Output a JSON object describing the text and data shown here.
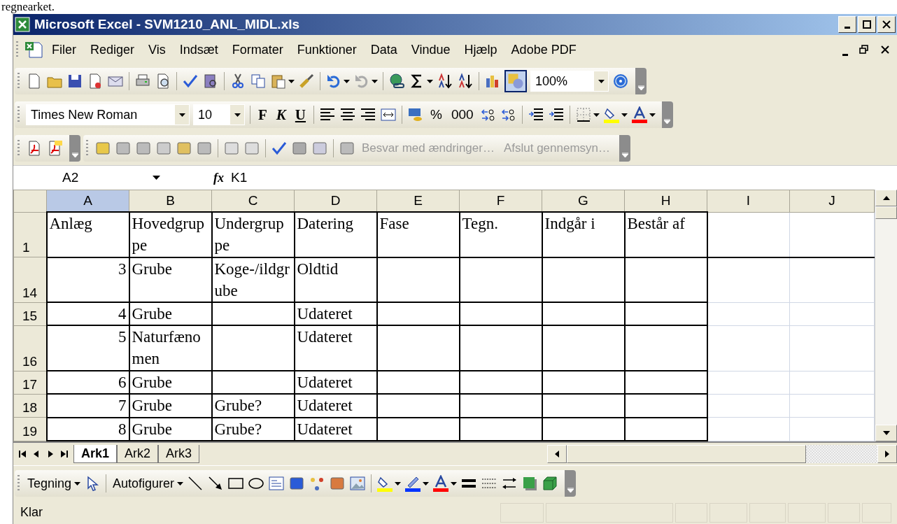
{
  "document_text": "regnearket.",
  "window": {
    "title": "Microsoft Excel - SVM1210_ANL_MIDL.xls"
  },
  "menu": [
    "Filer",
    "Rediger",
    "Vis",
    "Indsæt",
    "Formater",
    "Funktioner",
    "Data",
    "Vindue",
    "Hjælp",
    "Adobe PDF"
  ],
  "standard_toolbar": {
    "drawing_toggle_on": true,
    "zoom": "100%"
  },
  "formatting_toolbar": {
    "font": "Times New Roman",
    "size": "10",
    "style_buttons": [
      "F",
      "K",
      "U"
    ],
    "number_buttons": [
      "%",
      "000"
    ]
  },
  "reviewing_toolbar": {
    "reply": "Besvar med ændringer…",
    "end_review": "Afslut gennemsyn…"
  },
  "formula_bar": {
    "name_box": "A2",
    "function_label": "fx",
    "formula": "K1"
  },
  "sheet": {
    "columns": [
      {
        "label": "A",
        "selected": true
      },
      {
        "label": "B",
        "selected": false
      },
      {
        "label": "C",
        "selected": false
      },
      {
        "label": "D",
        "selected": false
      },
      {
        "label": "E",
        "selected": false
      },
      {
        "label": "F",
        "selected": false
      },
      {
        "label": "G",
        "selected": false
      },
      {
        "label": "H",
        "selected": false
      },
      {
        "label": "I",
        "selected": false
      },
      {
        "label": "J",
        "selected": false
      }
    ],
    "rows": [
      {
        "header": "1",
        "cells": [
          {
            "text": "Anlæg",
            "kind": "text"
          },
          {
            "text": "Hovedgruppe",
            "kind": "text"
          },
          {
            "text": "Undergruppe",
            "kind": "text"
          },
          {
            "text": "Datering",
            "kind": "text"
          },
          {
            "text": "Fase",
            "kind": "text"
          },
          {
            "text": "Tegn.",
            "kind": "text"
          },
          {
            "text": "Indgår i",
            "kind": "text"
          },
          {
            "text": "Består af",
            "kind": "text"
          }
        ]
      },
      {
        "header": "14",
        "cells": [
          {
            "text": "3",
            "kind": "number"
          },
          {
            "text": "Grube",
            "kind": "text"
          },
          {
            "text": "Koge-/ildgrube",
            "kind": "text"
          },
          {
            "text": "Oldtid",
            "kind": "text"
          }
        ]
      },
      {
        "header": "15",
        "cells": [
          {
            "text": "4",
            "kind": "number"
          },
          {
            "text": "Grube",
            "kind": "text"
          },
          null,
          {
            "text": "Udateret",
            "kind": "text"
          }
        ]
      },
      {
        "header": "16",
        "cells": [
          {
            "text": "5",
            "kind": "number"
          },
          {
            "text": "Naturfænomen",
            "kind": "text"
          },
          null,
          {
            "text": "Udateret",
            "kind": "text"
          }
        ]
      },
      {
        "header": "17",
        "cells": [
          {
            "text": "6",
            "kind": "number"
          },
          {
            "text": "Grube",
            "kind": "text"
          },
          null,
          {
            "text": "Udateret",
            "kind": "text"
          }
        ]
      },
      {
        "header": "18",
        "cells": [
          {
            "text": "7",
            "kind": "number"
          },
          {
            "text": "Grube",
            "kind": "text"
          },
          {
            "text": "Grube?",
            "kind": "text"
          },
          {
            "text": "Udateret",
            "kind": "text"
          }
        ]
      },
      {
        "header": "19",
        "cells": [
          {
            "text": "8",
            "kind": "number"
          },
          {
            "text": "Grube",
            "kind": "text"
          },
          {
            "text": "Grube?",
            "kind": "text"
          },
          {
            "text": "Udateret",
            "kind": "text"
          }
        ]
      }
    ]
  },
  "sheet_tabs": [
    {
      "label": "Ark1",
      "selected": true
    },
    {
      "label": "Ark2",
      "selected": false
    },
    {
      "label": "Ark3",
      "selected": false
    }
  ],
  "drawing_toolbar": {
    "draw_menu": "Tegning",
    "autoshapes_menu": "Autofigurer"
  },
  "status_bar": {
    "text": "Klar"
  }
}
